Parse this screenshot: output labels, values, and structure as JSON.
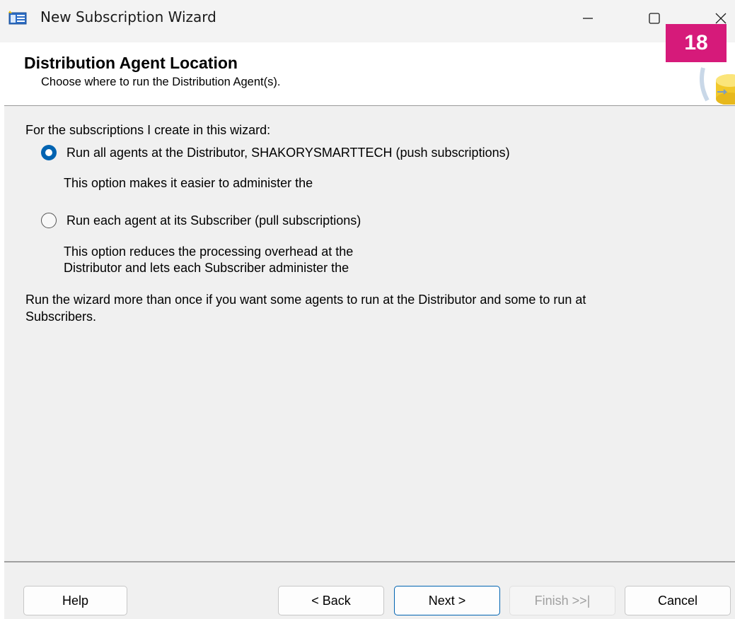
{
  "window": {
    "title": "New Subscription Wizard",
    "minimize_glyph": "—",
    "maximize_glyph": "☐",
    "close_glyph": "✕"
  },
  "badge": {
    "text": "18",
    "color": "#d61a7a"
  },
  "header": {
    "title": "Distribution Agent Location",
    "subtitle": "Choose where to run the Distribution Agent(s)."
  },
  "body": {
    "intro": "For the subscriptions I create in this wizard:",
    "options": [
      {
        "label": "Run all agents at the Distributor, SHAKORYSMARTTECH (push subscriptions)",
        "description_lines": [
          "This option makes it easier to administer the"
        ],
        "selected": true
      },
      {
        "label": "Run each agent at its Subscriber (pull subscriptions)",
        "description_lines": [
          "This option reduces the processing overhead at the",
          "Distributor and lets each Subscriber administer the"
        ],
        "selected": false
      }
    ],
    "footer_note_lines": [
      "Run the wizard more than once if you want some agents to run at the Distributor and some to run at",
      "Subscribers."
    ]
  },
  "buttons": {
    "help": "Help",
    "back": "< Back",
    "next": "Next >",
    "finish": "Finish >>|",
    "cancel": "Cancel"
  },
  "colors": {
    "accent": "#0063b1",
    "content_bg": "#f0f0f0",
    "disabled_text": "#a0a0a0"
  }
}
